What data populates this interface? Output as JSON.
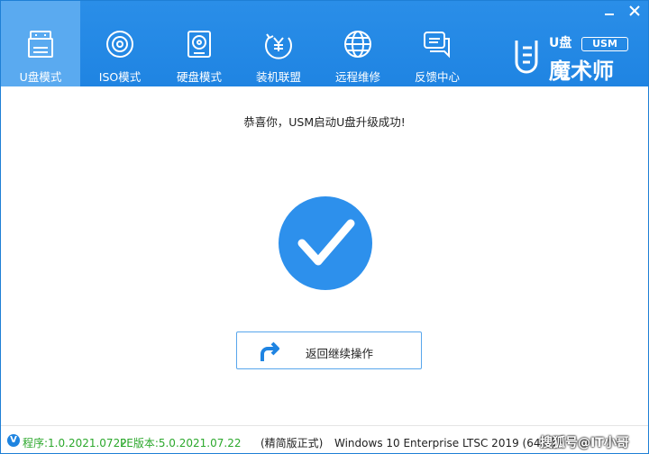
{
  "window_controls": {
    "minimize": "▬",
    "close": "✕"
  },
  "nav": {
    "items": [
      {
        "label": "U盘模式",
        "icon": "usb-drive-icon",
        "active": true
      },
      {
        "label": "ISO模式",
        "icon": "disc-icon",
        "active": false
      },
      {
        "label": "硬盘模式",
        "icon": "hard-disk-icon",
        "active": false
      },
      {
        "label": "装机联盟",
        "icon": "yen-coin-icon",
        "active": false
      },
      {
        "label": "远程维修",
        "icon": "globe-icon",
        "active": false
      },
      {
        "label": "反馈中心",
        "icon": "chat-bubble-icon",
        "active": false
      }
    ]
  },
  "logo": {
    "tag": "USM",
    "top": "U盘",
    "name": "魔术师"
  },
  "main": {
    "message": "恭喜你，USM启动U盘升级成功!",
    "return_button": "返回继续操作"
  },
  "status": {
    "version_badge": "V",
    "program_version": "程序:1.0.2021.0722",
    "pe_version": "PE版本:5.0.2021.07.22",
    "edition": "(精简版正式)",
    "os": "Windows 10 Enterprise LTSC 2019 (64位)",
    "watermark": "搜狐号@IT小哥"
  },
  "colors": {
    "accent": "#1f84e2",
    "success_green": "#2ca82c",
    "active_tab": "#5aaaf0"
  }
}
